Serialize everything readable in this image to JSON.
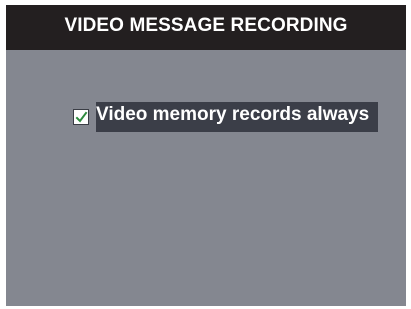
{
  "window": {
    "title": "VIDEO MESSAGE RECORDING"
  },
  "options": [
    {
      "label": "Video memory records always",
      "checked": true,
      "icon": "checkmark-icon"
    }
  ],
  "colors": {
    "title_bar": "#231f20",
    "screen_background": "#848790",
    "option_highlight": "#3b3e48",
    "checkmark": "#2e8b3e"
  }
}
